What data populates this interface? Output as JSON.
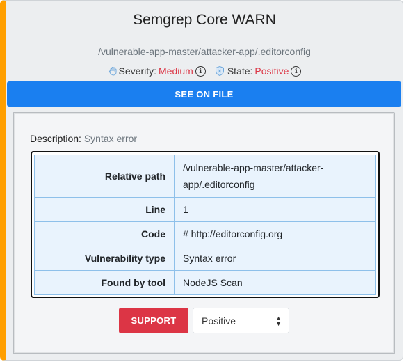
{
  "card": {
    "title": "Semgrep Core WARN",
    "file_path": "/vulnerable-app-master/attacker-app/.editorconfig",
    "severity_label": "Severity:",
    "severity_value": "Medium",
    "state_label": "State:",
    "state_value": "Positive",
    "accent_color": "#ff9f00",
    "see_on_file_label": "SEE ON FILE"
  },
  "details": {
    "description_label": "Description:",
    "description_value": "Syntax error",
    "rows": [
      {
        "key": "Relative path",
        "value": "/vulnerable-app-master/attacker-app/.editorconfig"
      },
      {
        "key": "Line",
        "value": "1"
      },
      {
        "key": "Code",
        "value": "# http://editorconfig.org"
      },
      {
        "key": "Vulnerability type",
        "value": "Syntax error"
      },
      {
        "key": "Found by tool",
        "value": "NodeJS Scan"
      }
    ]
  },
  "actions": {
    "support_label": "SUPPORT",
    "state_select_value": "Positive"
  },
  "icons": {
    "severity": "hand-icon",
    "state": "shield-icon",
    "info": "info-icon"
  }
}
